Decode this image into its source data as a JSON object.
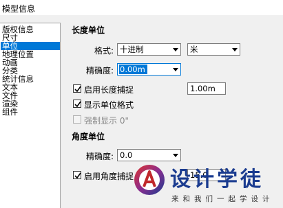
{
  "window": {
    "title": "模型信息"
  },
  "nav": {
    "items": [
      {
        "label": "版权信息"
      },
      {
        "label": "尺寸"
      },
      {
        "label": "单位"
      },
      {
        "label": "地理位置"
      },
      {
        "label": "动画"
      },
      {
        "label": "分类"
      },
      {
        "label": "统计信息"
      },
      {
        "label": "文本"
      },
      {
        "label": "文件"
      },
      {
        "label": "渲染"
      },
      {
        "label": "组件"
      }
    ],
    "selected": "单位"
  },
  "length_unit": {
    "heading": "长度单位",
    "format_label": "格式:",
    "format_value": "十进制",
    "unit_value": "米",
    "precision_label": "精确度:",
    "precision_value": "0.00m",
    "enable_snap_label": "启用长度捕捉",
    "enable_snap_checked": true,
    "snap_value": "1.00m",
    "show_unit_format_label": "显示单位格式",
    "show_unit_format_checked": true,
    "force_display_label": "强制显示 0\"",
    "force_display_checked": false,
    "force_display_disabled": true
  },
  "angle_unit": {
    "heading": "角度单位",
    "precision_label": "精确度:",
    "precision_value": "0.0",
    "enable_snap_label": "启用角度捕捉",
    "enable_snap_checked": true,
    "snap_value": "15.0"
  },
  "watermark": {
    "title": "设计学徒",
    "subtitle": "来和我们一起学设计"
  }
}
